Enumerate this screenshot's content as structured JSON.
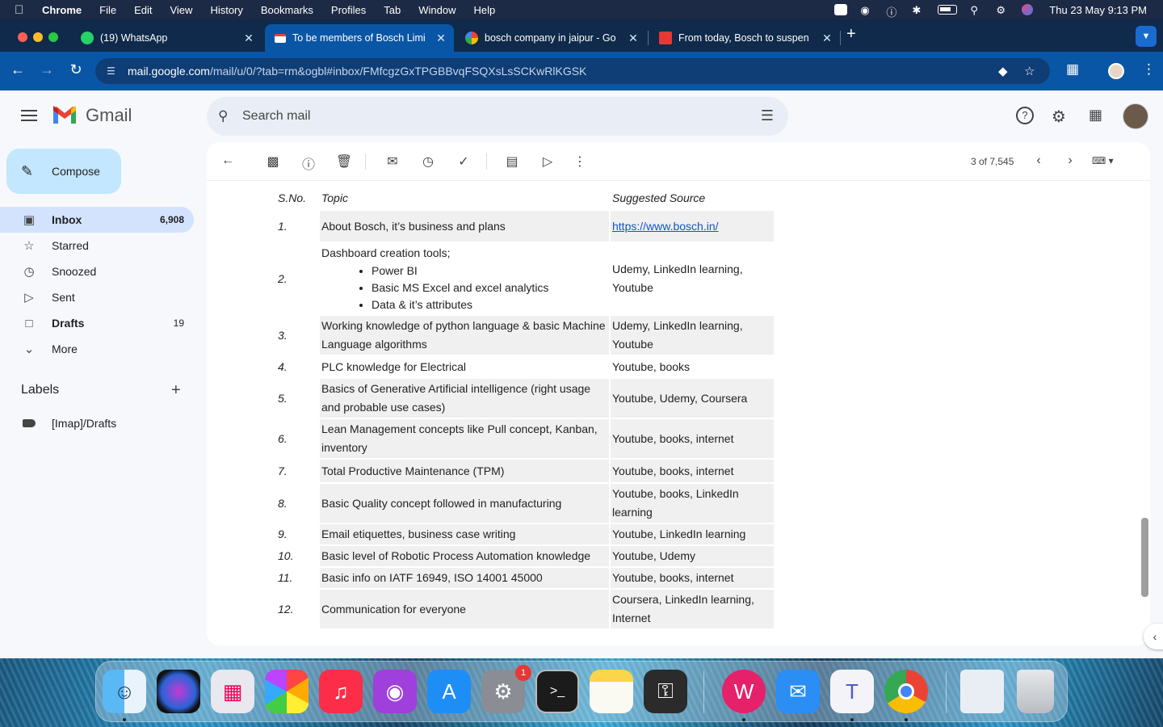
{
  "menubar": {
    "items": [
      "Chrome",
      "File",
      "Edit",
      "View",
      "History",
      "Bookmarks",
      "Profiles",
      "Tab",
      "Window",
      "Help"
    ],
    "clock": "Thu 23 May  9:13 PM"
  },
  "tabs": [
    {
      "title": "(19) WhatsApp"
    },
    {
      "title": "To be members of Bosch Limi"
    },
    {
      "title": "bosch company in jaipur - Go"
    },
    {
      "title": "From today, Bosch to suspen"
    }
  ],
  "omnibox": {
    "domain": "mail.google.com",
    "path": "/mail/u/0/?tab=rm&ogbl#inbox/FMfcgzGxTPGBBvqFSQXsLsSCKwRlKGSK"
  },
  "gmail": {
    "product": "Gmail",
    "search_placeholder": "Search mail",
    "compose": "Compose",
    "nav": [
      {
        "label": "Inbox",
        "count": "6,908",
        "icon": "inbox-icon"
      },
      {
        "label": "Starred",
        "count": "",
        "icon": "star-icon"
      },
      {
        "label": "Snoozed",
        "count": "",
        "icon": "clock-icon"
      },
      {
        "label": "Sent",
        "count": "",
        "icon": "send-icon"
      },
      {
        "label": "Drafts",
        "count": "19",
        "icon": "draft-icon"
      },
      {
        "label": "More",
        "count": "",
        "icon": "chevron-down-icon"
      }
    ],
    "labels_heading": "Labels",
    "labels": [
      "[Imap]/Drafts"
    ],
    "pager": "3 of 7,545"
  },
  "table": {
    "headers": [
      "S.No.",
      "Topic",
      "Suggested Source"
    ],
    "rows": [
      {
        "n": "1.",
        "topic": "About Bosch, it’s business and plans",
        "source": "https://www.bosch.in/"
      },
      {
        "n": "2.",
        "topic": "Dashboard creation tools;",
        "bullets": [
          "Power BI",
          "Basic MS Excel and excel analytics",
          "Data & it’s attributes"
        ],
        "source": "Udemy, LinkedIn learning, Youtube"
      },
      {
        "n": "3.",
        "topic": "Working knowledge of python language & basic Machine Language algorithms",
        "source": "Udemy, LinkedIn learning, Youtube"
      },
      {
        "n": "4.",
        "topic": "PLC knowledge for Electrical",
        "source": "Youtube, books"
      },
      {
        "n": "5.",
        "topic": "Basics of Generative Artificial intelligence (right usage and probable use cases)",
        "source": "Youtube, Udemy, Coursera"
      },
      {
        "n": "6.",
        "topic": "Lean Management concepts like Pull concept, Kanban, inventory",
        "source": "Youtube, books, internet"
      },
      {
        "n": "7.",
        "topic": "Total Productive Maintenance (TPM)",
        "source": "Youtube, books, internet"
      },
      {
        "n": "8.",
        "topic": "Basic Quality concept followed in manufacturing",
        "source": "Youtube, books, LinkedIn learning"
      },
      {
        "n": "9.",
        "topic": "Email etiquettes, business case writing",
        "source": "Youtube, LinkedIn learning"
      },
      {
        "n": "10.",
        "topic": "Basic level of Robotic Process Automation knowledge",
        "source": "Youtube, Udemy"
      },
      {
        "n": "11.",
        "topic": "Basic info on IATF 16949, ISO 14001 45000",
        "source": "Youtube, books, internet"
      },
      {
        "n": "12.",
        "topic": "Communication for everyone",
        "source": "Coursera, LinkedIn learning, Internet"
      }
    ]
  },
  "dock": {
    "settings_badge": "1",
    "apps": [
      "finder-icon",
      "siri-icon",
      "launchpad-icon",
      "photos-icon",
      "music-icon",
      "podcasts-icon",
      "app-store-icon",
      "system-settings-icon",
      "terminal-icon",
      "notes-icon",
      "keychain-icon",
      "wps-icon",
      "mail-icon",
      "teams-icon",
      "chrome-icon",
      "downloads-icon",
      "trash-icon"
    ]
  },
  "colors": {
    "accent": "#0a56a6",
    "compose": "#c2e7ff",
    "selected": "#d3e3fd"
  }
}
